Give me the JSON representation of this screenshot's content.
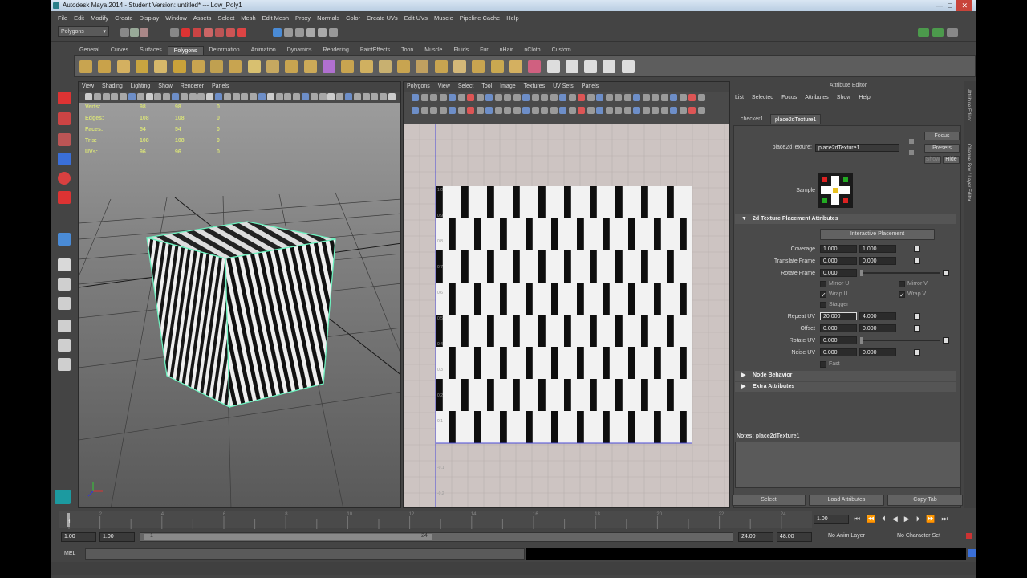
{
  "window": {
    "title": "Autodesk Maya 2014 - Student Version: untitled*   ---   Low_Poly1",
    "controls": [
      "—",
      "□",
      "✕"
    ]
  },
  "menubar": [
    "File",
    "Edit",
    "Modify",
    "Create",
    "Display",
    "Window",
    "Assets",
    "Select",
    "Mesh",
    "Edit Mesh",
    "Proxy",
    "Normals",
    "Color",
    "Create UVs",
    "Edit UVs",
    "Muscle",
    "Pipeline Cache",
    "Help"
  ],
  "status": {
    "mode": "Polygons"
  },
  "shelf": {
    "tabs": [
      "General",
      "Curves",
      "Surfaces",
      "Polygons",
      "Deformation",
      "Animation",
      "Dynamics",
      "Rendering",
      "PaintEffects",
      "Toon",
      "Muscle",
      "Fluids",
      "Fur",
      "nHair",
      "nCloth",
      "Custom"
    ],
    "active": "Polygons"
  },
  "viewport": {
    "menu": [
      "View",
      "Shading",
      "Lighting",
      "Show",
      "Renderer",
      "Panels"
    ],
    "hud": {
      "labels": [
        "Verts:",
        "Edges:",
        "Faces:",
        "Tris:",
        "UVs:"
      ],
      "col1": [
        "98",
        "108",
        "54",
        "108",
        "96"
      ],
      "col2": [
        "98",
        "108",
        "54",
        "108",
        "96"
      ],
      "col3": [
        "0",
        "0",
        "0",
        "0",
        "0"
      ]
    }
  },
  "uv_editor": {
    "menu": [
      "Polygons",
      "View",
      "Select",
      "Tool",
      "Image",
      "Textures",
      "UV Sets",
      "Panels"
    ],
    "ticks": [
      "1.0",
      "0.9",
      "0.8",
      "0.7",
      "0.6",
      "0.5",
      "0.4",
      "0.3",
      "0.2",
      "0.1"
    ],
    "below_ticks": [
      "-0.1",
      "-0.2"
    ]
  },
  "attribute_editor": {
    "title": "Attribute Editor",
    "menu": [
      "List",
      "Selected",
      "Focus",
      "Attributes",
      "Show",
      "Help"
    ],
    "tabs": [
      "checker1",
      "place2dTexture1"
    ],
    "active_tab": "place2dTexture1",
    "node_label": "place2dTexture:",
    "node_name": "place2dTexture1",
    "buttons": {
      "focus": "Focus",
      "presets": "Presets",
      "show": "Show",
      "hide": "Hide"
    },
    "sample_label": "Sample",
    "section_placement": "2d Texture Placement Attributes",
    "interactive_placement": "Interactive Placement",
    "coverage": {
      "label": "Coverage",
      "u": "1.000",
      "v": "1.000"
    },
    "translate_frame": {
      "label": "Translate Frame",
      "u": "0.000",
      "v": "0.000"
    },
    "rotate_frame": {
      "label": "Rotate Frame",
      "v": "0.000"
    },
    "mirror_u": "Mirror U",
    "mirror_v": "Mirror V",
    "wrap_u": "Wrap U",
    "wrap_v": "Wrap V",
    "stagger": "Stagger",
    "repeat_uv": {
      "label": "Repeat UV",
      "u": "20.000",
      "v": "4.000"
    },
    "offset": {
      "label": "Offset",
      "u": "0.000",
      "v": "0.000"
    },
    "rotate_uv": {
      "label": "Rotate UV",
      "v": "0.000"
    },
    "noise_uv": {
      "label": "Noise UV",
      "u": "0.000",
      "v": "0.000"
    },
    "fast": "Fast",
    "section_node_behavior": "Node Behavior",
    "section_extra": "Extra Attributes",
    "notes_label": "Notes:  place2dTexture1",
    "bottom_buttons": [
      "Select",
      "Load Attributes",
      "Copy Tab"
    ]
  },
  "sidebar_tabs": [
    "Attribute Editor",
    "Channel Box / Layer Editor"
  ],
  "timeline": {
    "ticks": [
      "1",
      "2",
      "4",
      "6",
      "8",
      "10",
      "12",
      "14",
      "16",
      "18",
      "20",
      "22",
      "24"
    ],
    "current_frame": "1.00"
  },
  "range": {
    "start": "1.00",
    "inner_start": "1.00",
    "slider_start": "1",
    "slider_end": "24",
    "end": "24.00",
    "outer_end": "48.00",
    "anim_layer": "No Anim Layer",
    "character_set": "No Character Set"
  },
  "command": {
    "label": "MEL"
  }
}
